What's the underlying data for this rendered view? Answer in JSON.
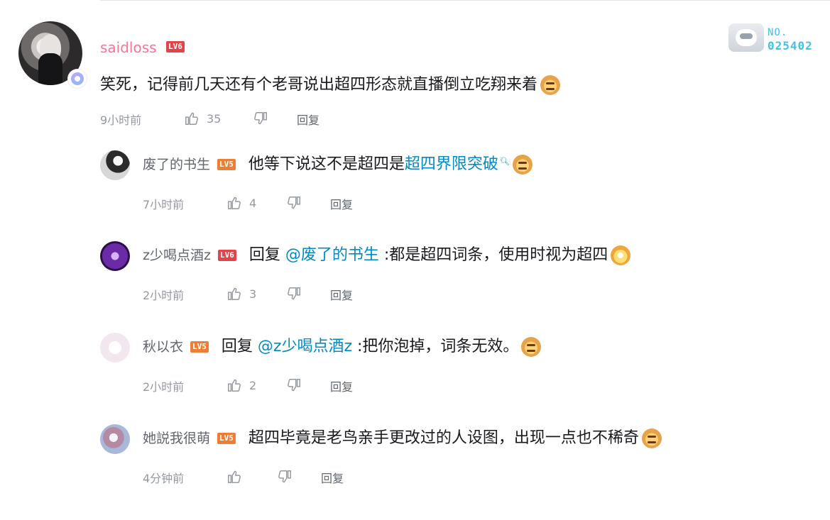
{
  "main_comment": {
    "username": "saidloss",
    "level": "LV6",
    "text": "笑死，记得前几天还有个老哥说出超四形态就直播倒立吃翔来着",
    "time": "9小时前",
    "likes": "35",
    "reply_label": "回复",
    "pendant": {
      "no_label": "NO.",
      "id": "025402"
    }
  },
  "replies": [
    {
      "username": "废了的书生",
      "level": "LV5",
      "text_before_link": "他等下说这不是超四是",
      "link_text": "超四界限突破",
      "time": "7小时前",
      "likes": "4",
      "reply_label": "回复"
    },
    {
      "username": "z少喝点酒z",
      "level": "LV6",
      "prefix": "回复",
      "mention": "@废了的书生",
      "text": ":都是超四词条，使用时视为超四",
      "time": "2小时前",
      "likes": "3",
      "reply_label": "回复"
    },
    {
      "username": "秋以衣",
      "level": "LV5",
      "prefix": "回复",
      "mention": "@z少喝点酒z",
      "text": ":把你泡掉，词条无效。",
      "time": "2小时前",
      "likes": "2",
      "reply_label": "回复"
    },
    {
      "username": "她説我很萌",
      "level": "LV5",
      "text": "超四毕竟是老鸟亲手更改过的人设图，出现一点也不稀奇",
      "time": "4分钟前",
      "likes": "",
      "reply_label": "回复"
    }
  ]
}
